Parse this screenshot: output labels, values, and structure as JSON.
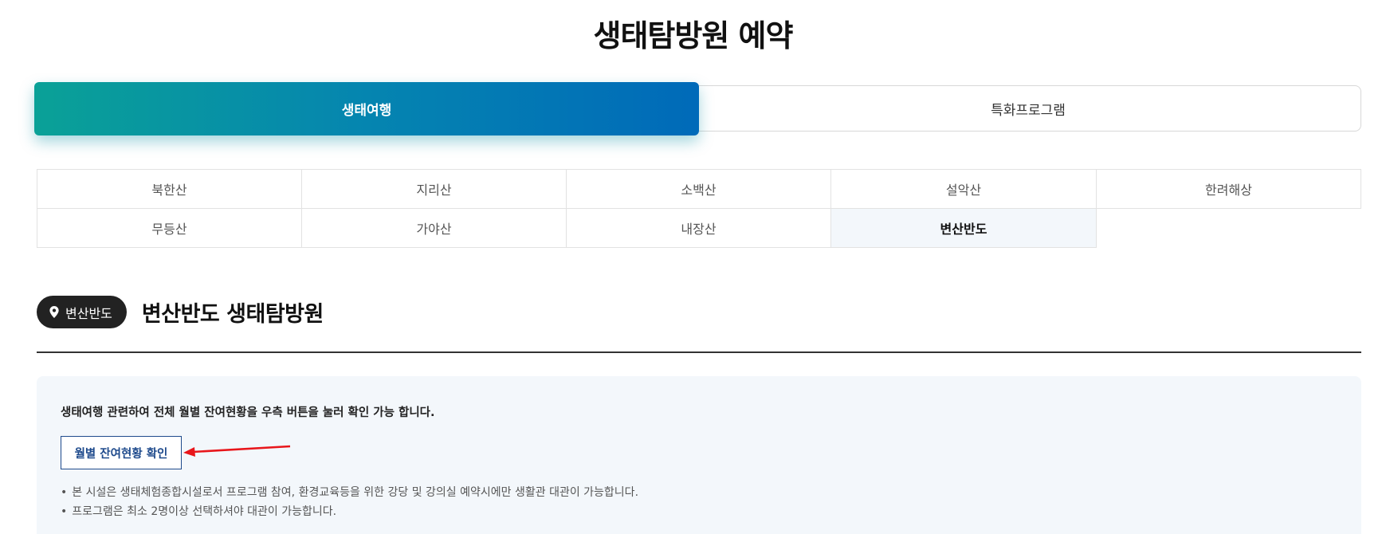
{
  "page": {
    "title": "생태탐방원 예약"
  },
  "tabs": [
    {
      "label": "생태여행",
      "active": true
    },
    {
      "label": "특화프로그램",
      "active": false
    }
  ],
  "regions": [
    {
      "label": "북한산",
      "active": false
    },
    {
      "label": "지리산",
      "active": false
    },
    {
      "label": "소백산",
      "active": false
    },
    {
      "label": "설악산",
      "active": false
    },
    {
      "label": "한려해상",
      "active": false
    },
    {
      "label": "무등산",
      "active": false
    },
    {
      "label": "가야산",
      "active": false
    },
    {
      "label": "내장산",
      "active": false
    },
    {
      "label": "변산반도",
      "active": true
    }
  ],
  "section": {
    "badge_label": "변산반도",
    "badge_icon": "map-pin-icon",
    "title": "변산반도 생태탐방원"
  },
  "info": {
    "text": "생태여행 관련하여 전체 월별 잔여현황을 우측 버튼을 눌러 확인 가능 합니다.",
    "button_label": "월별 잔여현황 확인",
    "notes": [
      "본 시설은 생태체험종합시설로서 프로그램 참여, 환경교육등을 위한 강당 및 강의실 예약시에만 생활관 대관이 가능합니다.",
      "프로그램은 최소 2명이상 선택하셔야 대관이 가능합니다."
    ]
  },
  "colors": {
    "tab_gradient_start": "#0aa197",
    "tab_gradient_end": "#006ab9",
    "button_accent": "#1e4a8c",
    "annotation_arrow": "#e8161b",
    "info_bg": "#f3f7fb"
  }
}
